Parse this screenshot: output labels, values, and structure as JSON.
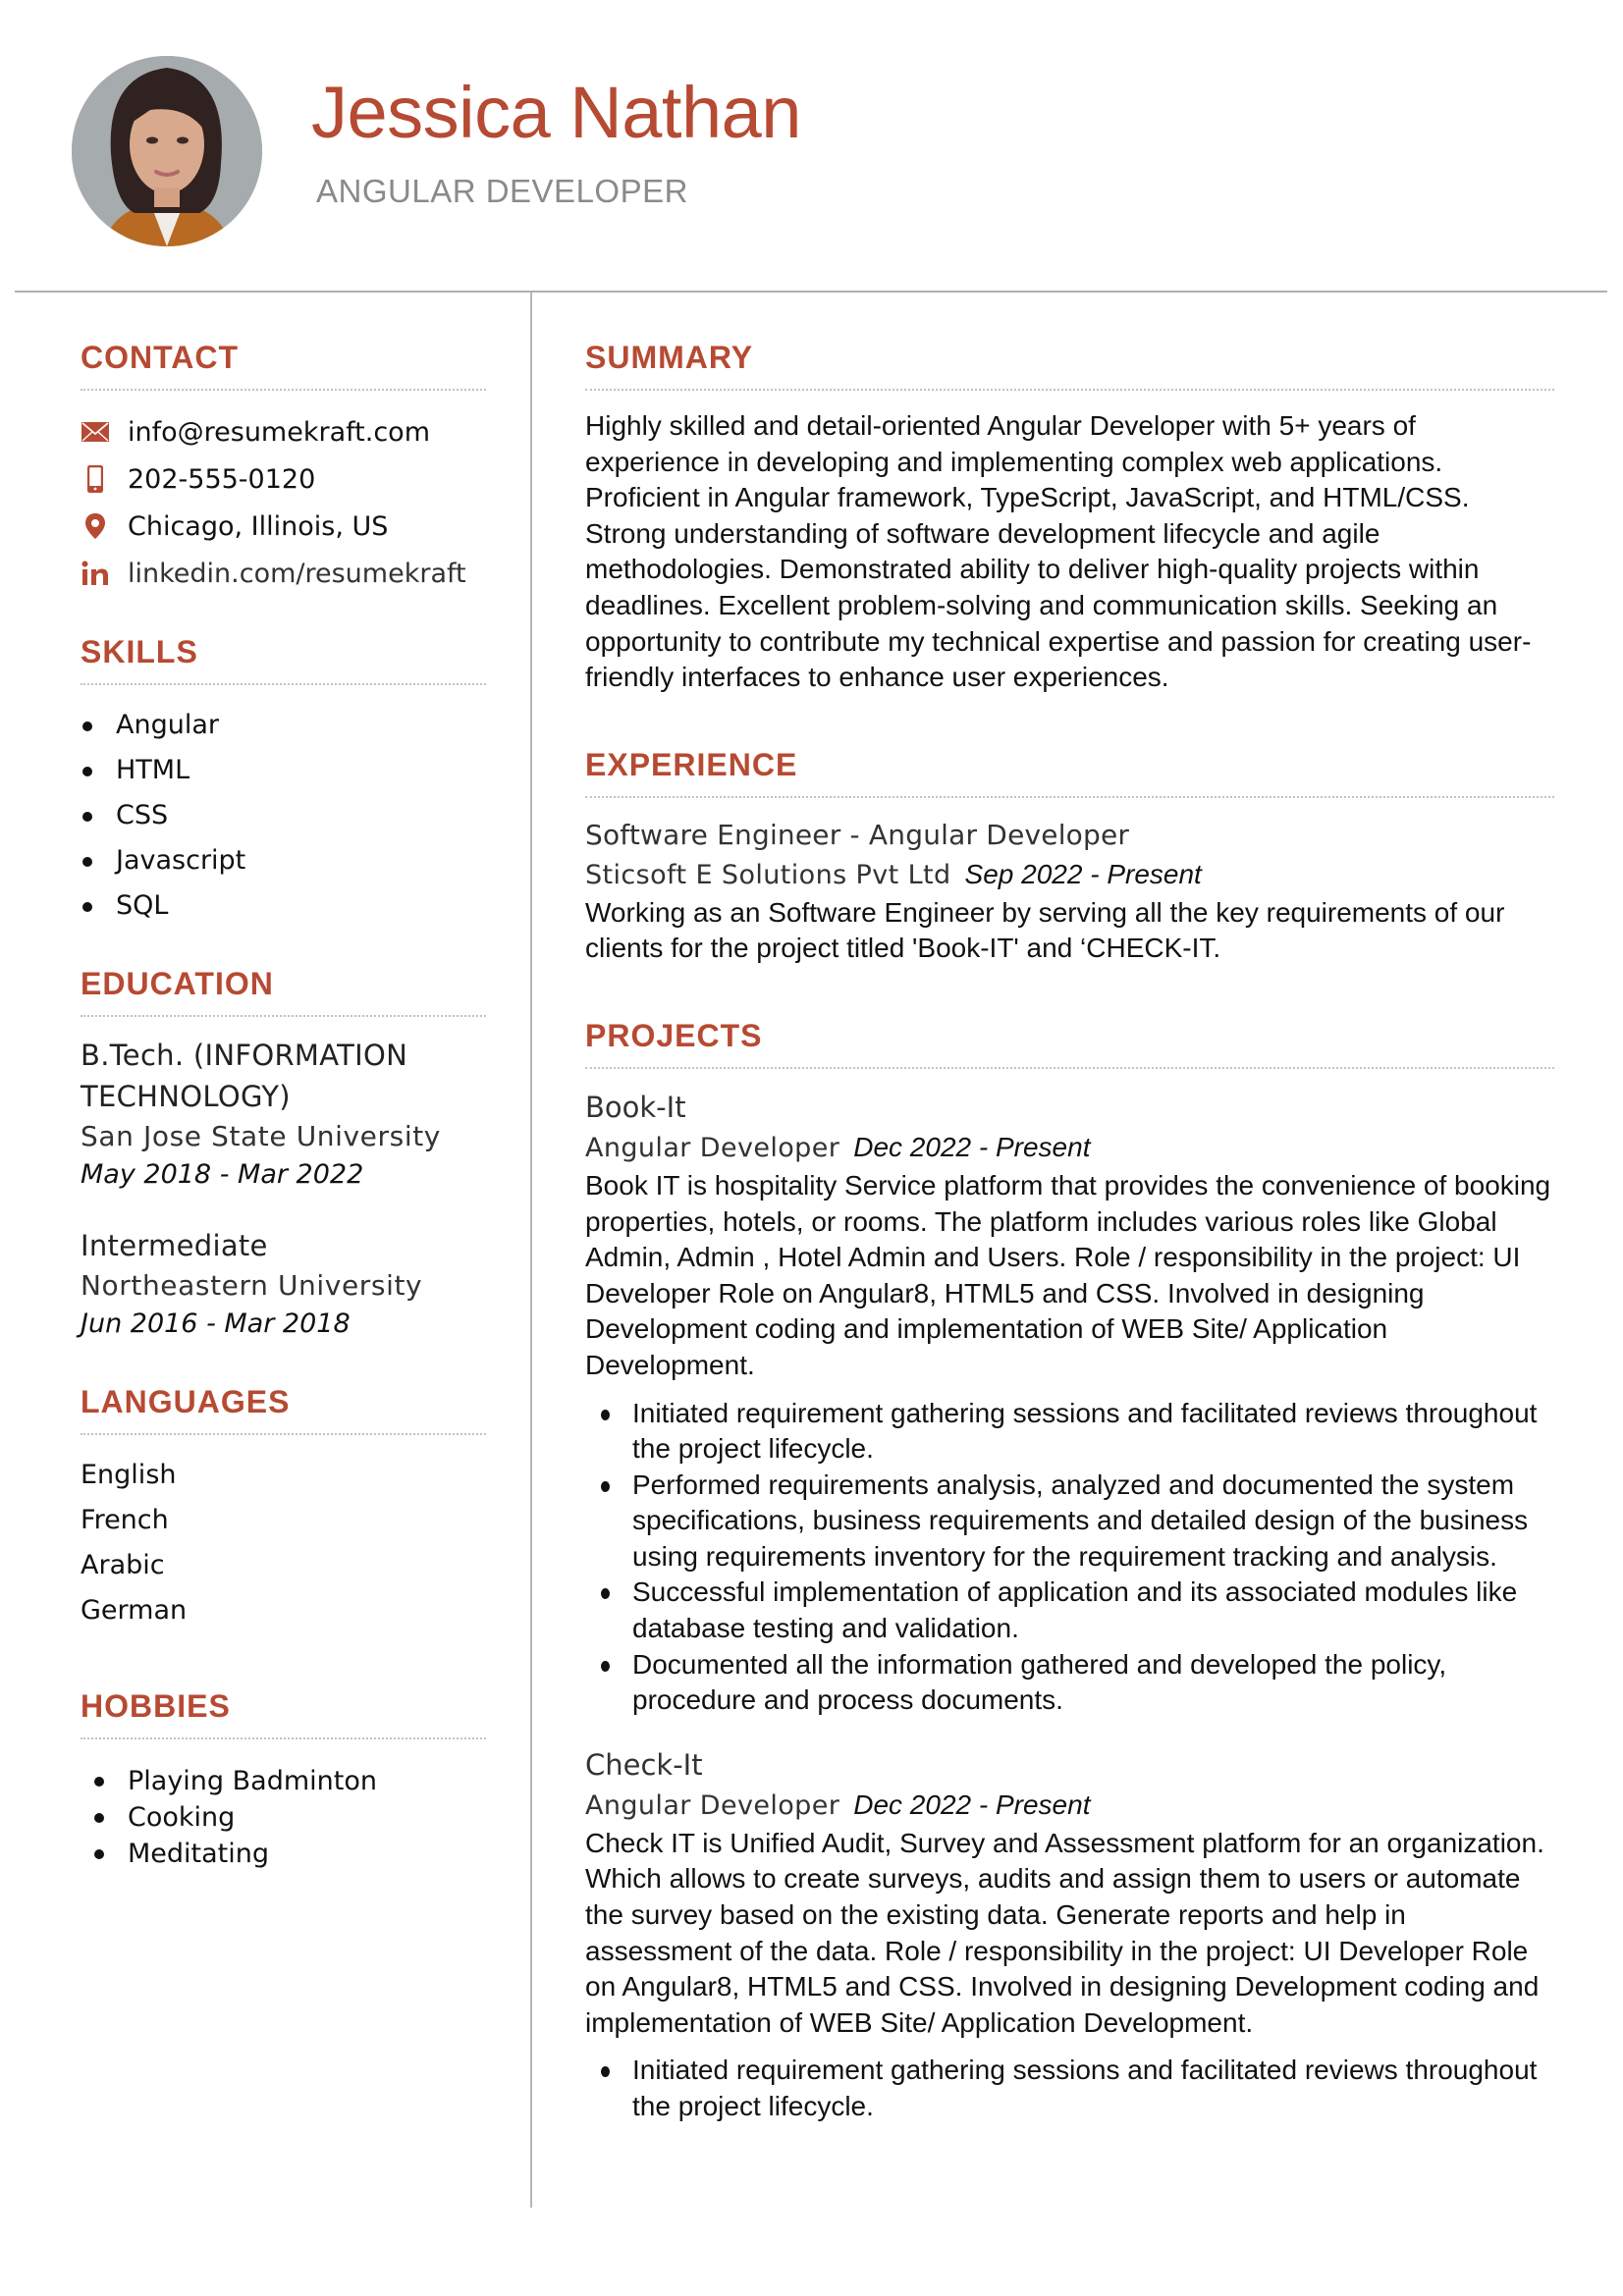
{
  "header": {
    "name": "Jessica Nathan",
    "title": "ANGULAR DEVELOPER",
    "photo_alt": "profile-photo",
    "accent_color": "#b64a32"
  },
  "contact": {
    "heading": "CONTACT",
    "items": [
      {
        "icon": "envelope-icon",
        "text": "info@resumekraft.com"
      },
      {
        "icon": "mobile-phone-icon",
        "text": "202-555-0120"
      },
      {
        "icon": "map-pin-icon",
        "text": "Chicago, Illinois, US"
      },
      {
        "icon": "linkedin-icon",
        "text": "linkedin.com/resumekraft"
      }
    ]
  },
  "skills": {
    "heading": "SKILLS",
    "items": [
      "Angular",
      "HTML",
      "CSS",
      "Javascript",
      "SQL"
    ]
  },
  "education": {
    "heading": "EDUCATION",
    "items": [
      {
        "degree": "B.Tech. (INFORMATION TECHNOLOGY)",
        "school": "San Jose State University",
        "dates": "May 2018 - Mar 2022"
      },
      {
        "degree": "Intermediate",
        "school": "Northeastern University",
        "dates": "Jun 2016 - Mar 2018"
      }
    ]
  },
  "languages": {
    "heading": "LANGUAGES",
    "items": [
      "English",
      "French",
      "Arabic",
      "German"
    ]
  },
  "hobbies": {
    "heading": "HOBBIES",
    "items": [
      "Playing Badminton",
      "Cooking",
      "Meditating"
    ]
  },
  "summary": {
    "heading": "SUMMARY",
    "text": "Highly skilled and detail-oriented Angular Developer with 5+ years of experience in developing and implementing complex web applications. Proficient in Angular framework, TypeScript, JavaScript, and HTML/CSS. Strong understanding of software development lifecycle and agile methodologies. Demonstrated ability to deliver high-quality projects within deadlines. Excellent problem-solving and communication skills. Seeking an opportunity to contribute my technical expertise and passion for creating user-friendly interfaces to enhance user experiences."
  },
  "experience": {
    "heading": "EXPERIENCE",
    "items": [
      {
        "title": "Software Engineer - Angular Developer",
        "company": "Sticsoft E Solutions Pvt Ltd",
        "dates": "Sep 2022 - Present",
        "description": "Working as an Software Engineer by serving all the key requirements of our clients for the project titled 'Book-IT' and ‘CHECK-IT."
      }
    ]
  },
  "projects": {
    "heading": "PROJECTS",
    "items": [
      {
        "name": "Book-It",
        "role": "Angular Developer",
        "dates": "Dec 2022 - Present",
        "description": "Book IT is hospitality Service platform that provides the convenience of booking properties, hotels, or rooms. The platform includes various roles like Global Admin, Admin , Hotel Admin and Users. Role / responsibility in the project: UI Developer Role on Angular8, HTML5 and CSS. Involved in designing Development coding and implementation of WEB Site/ Application Development.",
        "bullets": [
          "Initiated requirement gathering sessions and facilitated reviews throughout the project lifecycle.",
          "Performed requirements analysis, analyzed and documented the system specifications, business requirements and detailed design of the business using requirements inventory for the requirement tracking and analysis.",
          "Successful implementation of application and its associated modules like database testing and validation.",
          "Documented all the information gathered and developed the policy, procedure and process documents."
        ]
      },
      {
        "name": "Check-It",
        "role": "Angular Developer",
        "dates": "Dec 2022 - Present",
        "description": "Check IT is Unified Audit, Survey and Assessment platform for an organization. Which allows to create surveys, audits and assign them to users or automate the survey based on the existing data. Generate reports and help in assessment of the data. Role / responsibility in the project: UI Developer Role on Angular8, HTML5 and CSS. Involved in designing Development coding and implementation of WEB Site/ Application Development.",
        "bullets": [
          "Initiated requirement gathering sessions and facilitated reviews throughout the project lifecycle."
        ]
      }
    ]
  }
}
